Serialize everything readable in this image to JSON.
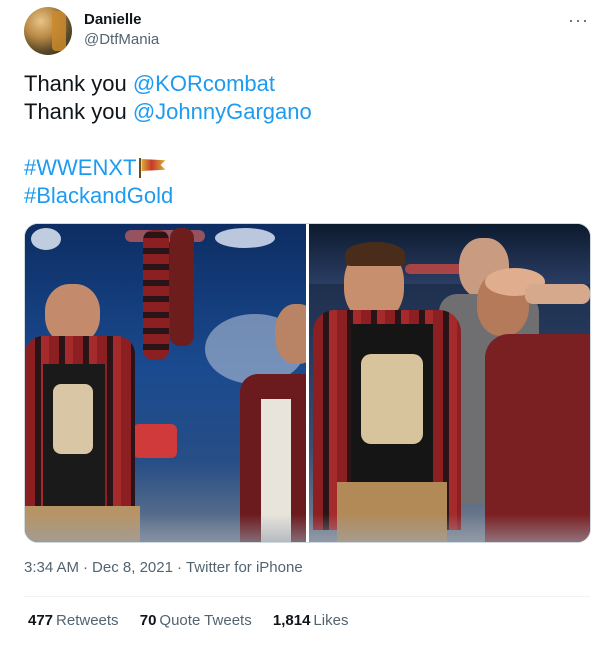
{
  "author": {
    "name": "Danielle",
    "handle": "@DtfMania",
    "avatar_icon": "profile-photo",
    "more_icon": "more-horizontal-icon",
    "more_glyph": "···"
  },
  "tweet": {
    "lines": [
      {
        "prefix": "Thank you ",
        "mention": "@KORcombat"
      },
      {
        "prefix": "Thank you ",
        "mention": "@JohnnyGargano"
      }
    ],
    "hashtags": [
      "#WWENXT",
      "#BlackandGold"
    ],
    "hashflag_icon": "nxt-hashflag-icon"
  },
  "media": {
    "photos": [
      {
        "description_icon": "photo-raised-hand"
      },
      {
        "description_icon": "photo-group-hug"
      }
    ]
  },
  "meta": {
    "time": "3:34 AM",
    "date": "Dec 8, 2021",
    "source": "Twitter for iPhone",
    "separator": "·"
  },
  "stats": {
    "retweets": {
      "count": "477",
      "label": "Retweets"
    },
    "quote_tweets": {
      "count": "70",
      "label": "Quote Tweets"
    },
    "likes": {
      "count": "1,814",
      "label": "Likes"
    }
  },
  "colors": {
    "link": "#1d9bf0",
    "secondary_text": "#536471",
    "primary_text": "#0f1419"
  }
}
